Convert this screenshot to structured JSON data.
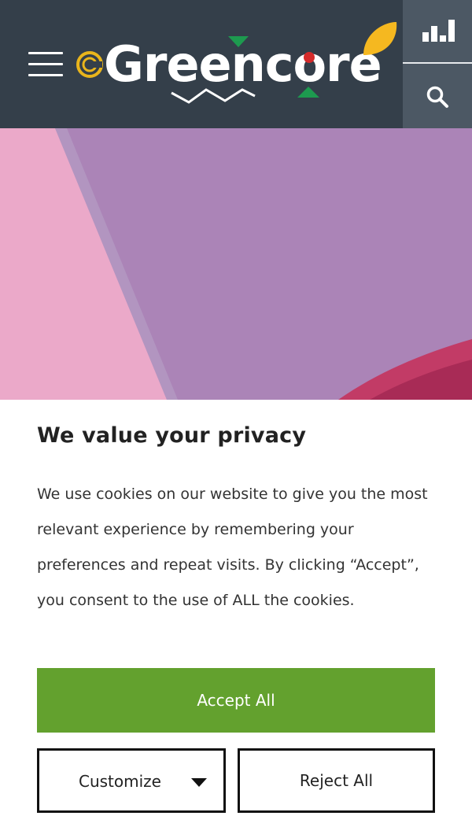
{
  "header": {
    "logo_text": "Greencore",
    "menu_icon": "hamburger-menu-icon",
    "stats_icon": "bar-chart-icon",
    "search_icon": "search-icon",
    "colors": {
      "bg": "#343f4a",
      "side": "#4c5864"
    }
  },
  "hero": {
    "colors": [
      "#ab84b7",
      "#e8a8c8",
      "#c03060"
    ]
  },
  "cookie_banner": {
    "title": "We value your privacy",
    "body": "We use cookies on our website to give you the most relevant experience by remembering your preferences and repeat visits. By clicking “Accept”, you consent to the use of ALL the cookies.",
    "accept_label": "Accept All",
    "customize_label": "Customize",
    "reject_label": "Reject All",
    "accept_color": "#63a12e"
  }
}
